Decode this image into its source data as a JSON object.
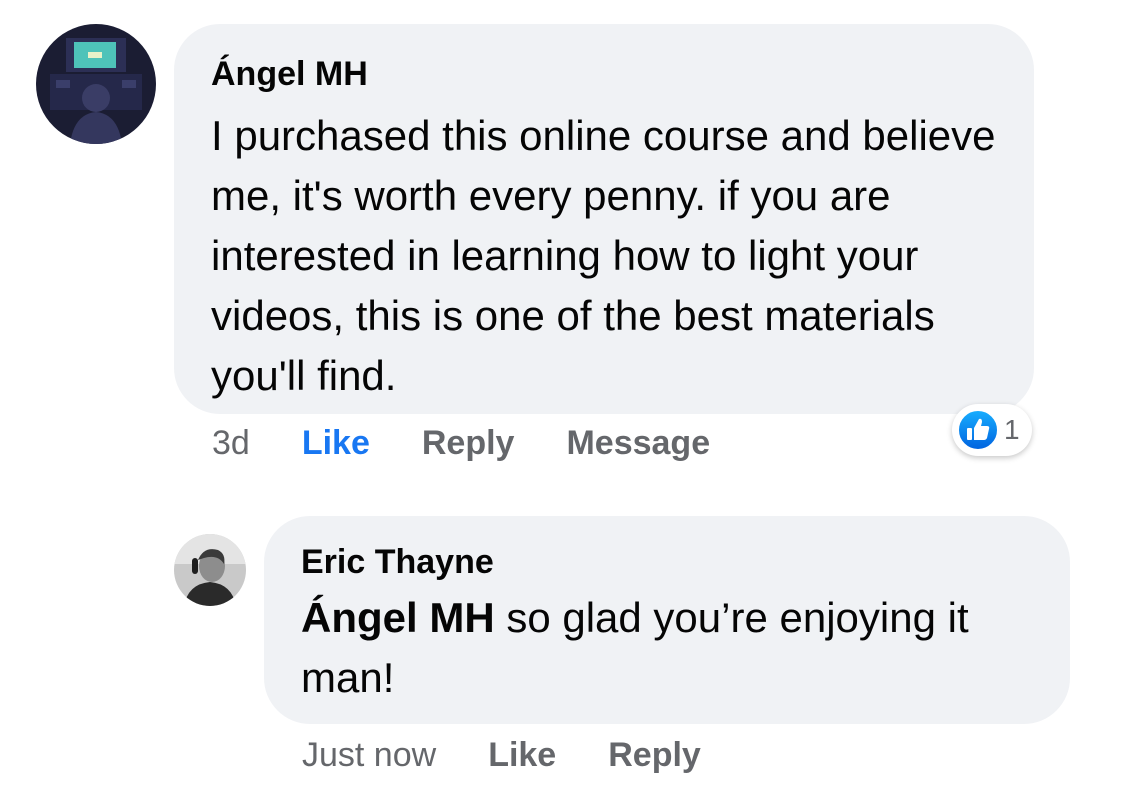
{
  "comments": [
    {
      "author": "Ángel MH",
      "text": "I purchased this online course and believe me, it's worth every penny. if you are interested in learning how to light your videos, this is one of the best materials you'll find.",
      "timestamp": "3d",
      "actions": {
        "like": "Like",
        "reply": "Reply",
        "message": "Message"
      },
      "reactions": {
        "icon": "thumbs-up-icon",
        "count": "1"
      }
    },
    {
      "author": "Eric Thayne",
      "mention": "Ángel MH",
      "text": " so glad you’re enjoying it man!",
      "timestamp": "Just now",
      "actions": {
        "like": "Like",
        "reply": "Reply"
      }
    }
  ],
  "colors": {
    "bubble": "#f0f2f5",
    "like_active": "#1877f2",
    "secondary_text": "#65676b"
  }
}
